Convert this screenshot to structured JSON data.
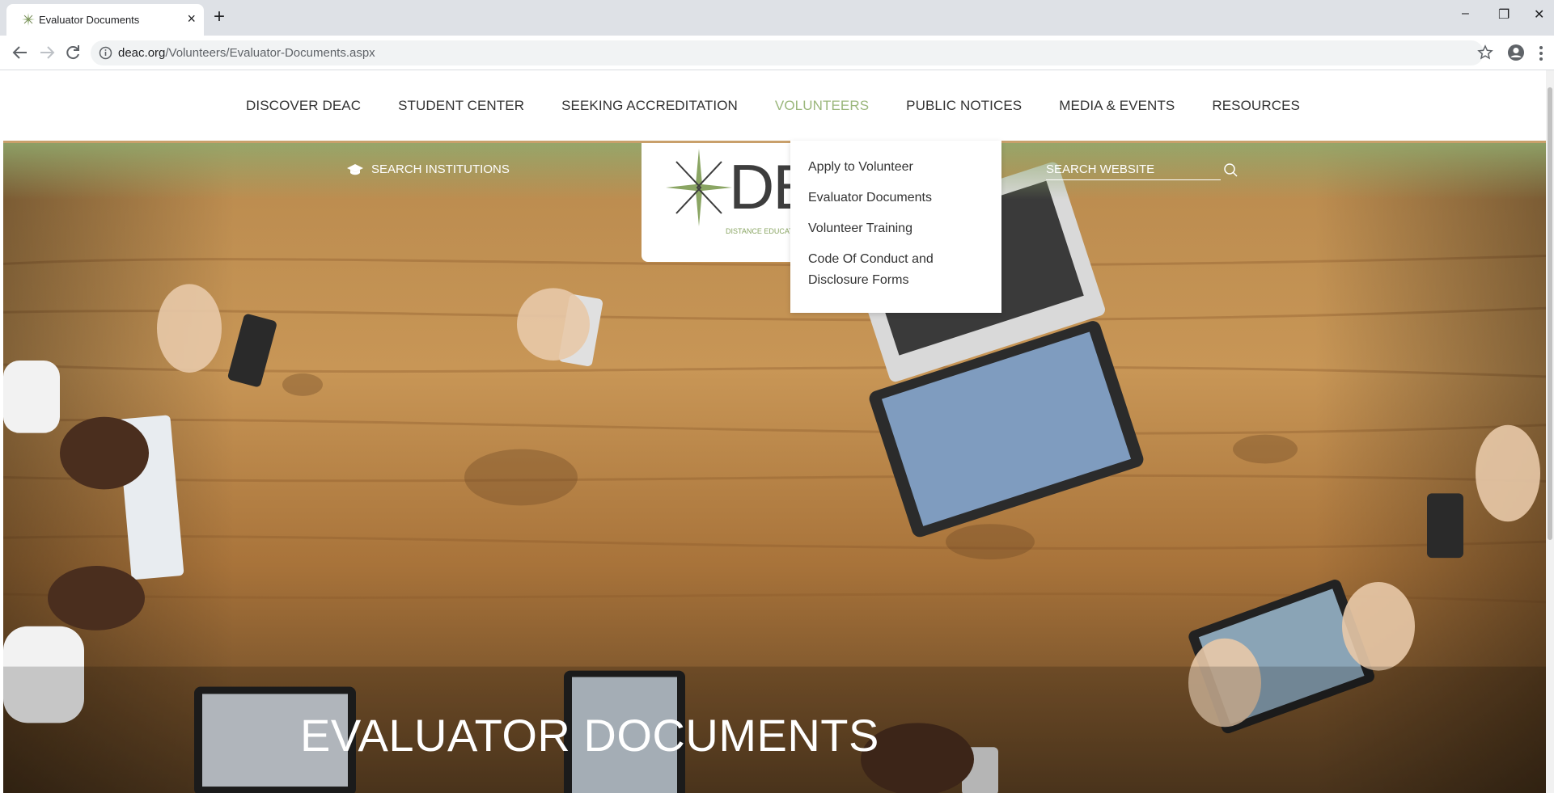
{
  "browser": {
    "tab_title": "Evaluator Documents",
    "tab_close": "×",
    "new_tab": "+",
    "url_host": "deac.org",
    "url_path": "/Volunteers/Evaluator-Documents.aspx",
    "window_minimize": "–",
    "window_restore": "❐",
    "window_close": "✕"
  },
  "nav": {
    "items": [
      {
        "label": "DISCOVER DEAC",
        "active": false
      },
      {
        "label": "STUDENT CENTER",
        "active": false
      },
      {
        "label": "SEEKING ACCREDITATION",
        "active": false
      },
      {
        "label": "VOLUNTEERS",
        "active": true
      },
      {
        "label": "PUBLIC NOTICES",
        "active": false
      },
      {
        "label": "MEDIA & EVENTS",
        "active": false
      },
      {
        "label": "RESOURCES",
        "active": false
      }
    ]
  },
  "header": {
    "search_institutions": "SEARCH INSTITUTIONS",
    "search_website_placeholder": "SEARCH WEBSITE",
    "logo_letters": "DE",
    "logo_subtitle": "DISTANCE EDUCATIO"
  },
  "dropdown": {
    "items": [
      {
        "label": "Apply to Volunteer"
      },
      {
        "label": "Evaluator Documents"
      },
      {
        "label": "Volunteer Training"
      },
      {
        "label": "Code Of Conduct and Disclosure Forms"
      }
    ]
  },
  "hero": {
    "title": "EVALUATOR DOCUMENTS"
  },
  "colors": {
    "active_nav": "#9bb77c",
    "brand_green": "#8aa563",
    "hero_band": "#91aa6e"
  }
}
